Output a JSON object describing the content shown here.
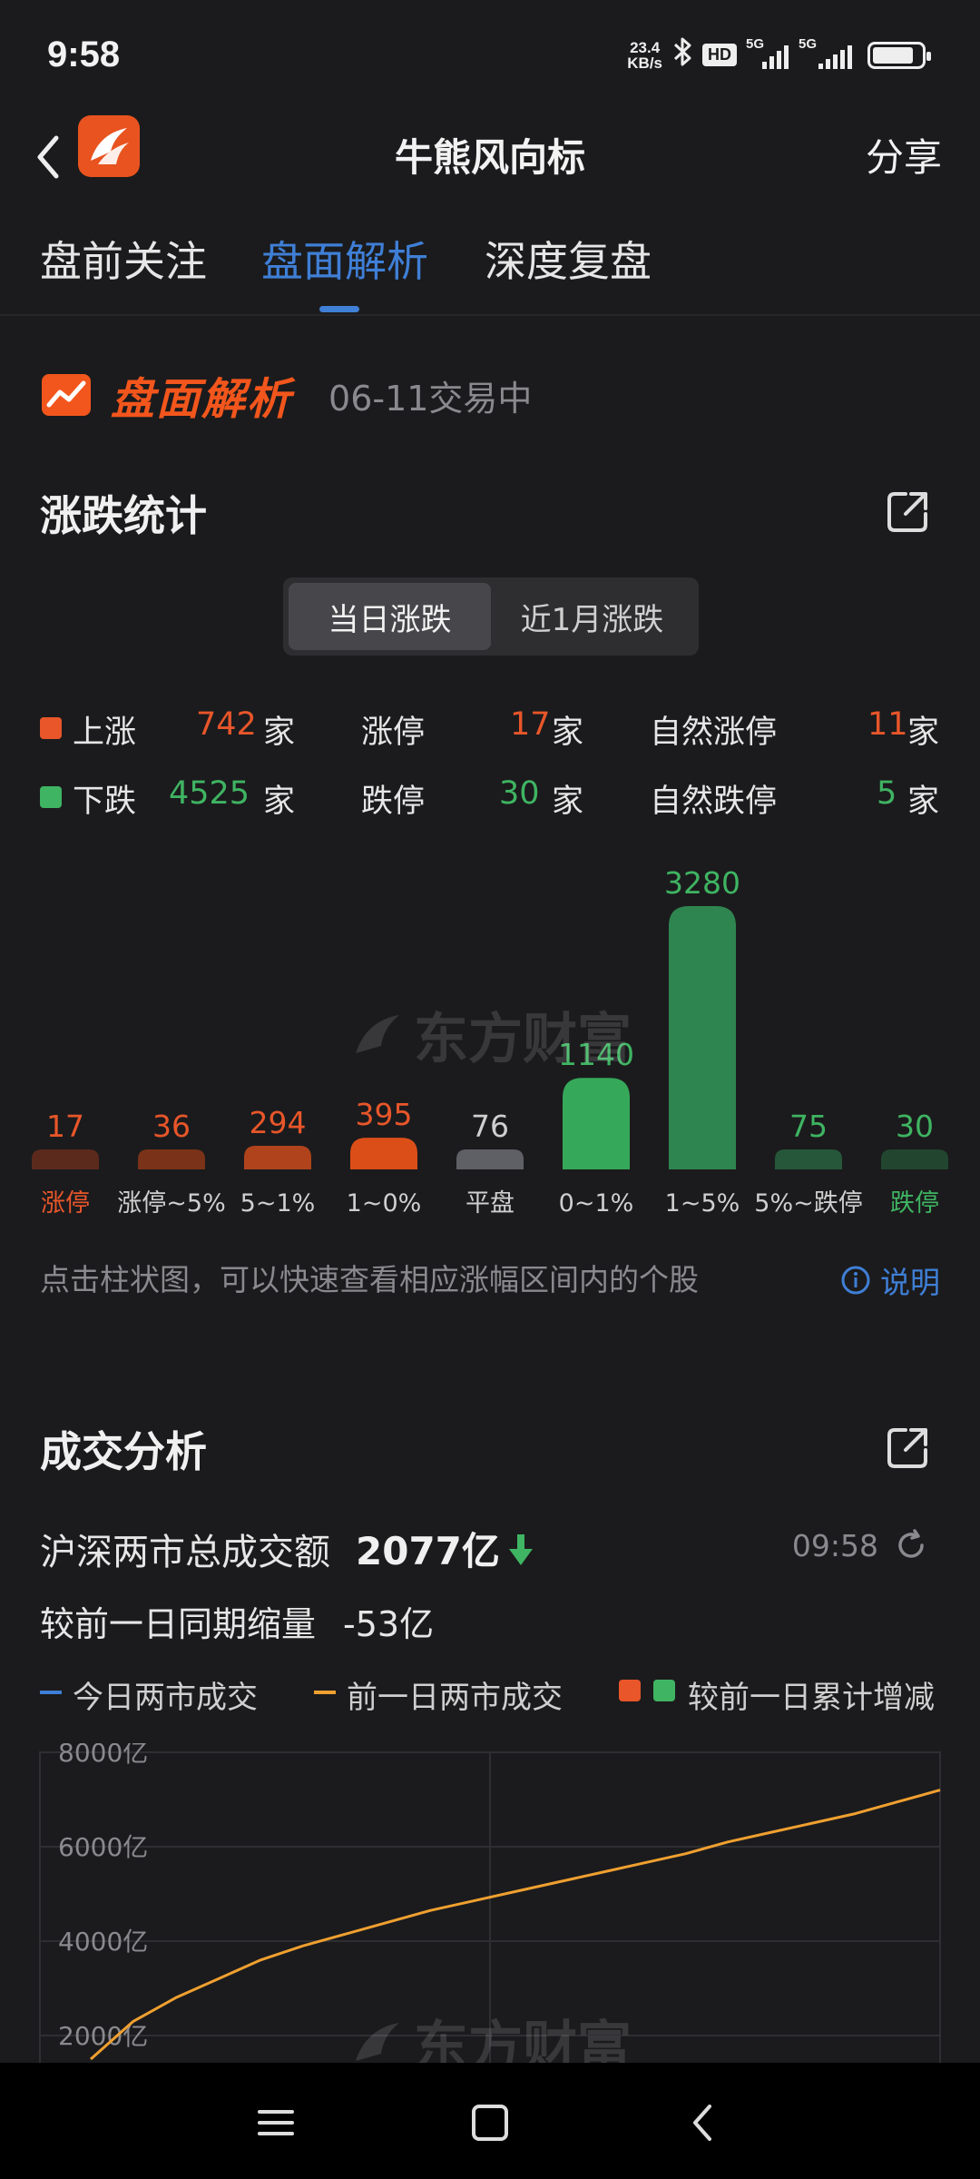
{
  "status": {
    "time": "9:58",
    "net_speed_value": "23.4",
    "net_speed_unit": "KB/s",
    "bluetooth_icon": "bluetooth-icon",
    "hd_badge": "HD",
    "signal_label_1": "5G",
    "signal_label_2": "5G",
    "battery_level": 0.85
  },
  "appbar": {
    "title": "牛熊风向标",
    "share": "分享",
    "back_icon": "back-arrow-icon",
    "logo_icon": "eastmoney-logo-icon"
  },
  "tabs": [
    {
      "label": "盘前关注",
      "active": false
    },
    {
      "label": "盘面解析",
      "active": true
    },
    {
      "label": "深度复盘",
      "active": false
    }
  ],
  "section": {
    "icon": "trend-chart-icon",
    "title": "盘面解析",
    "date": "06-11交易中"
  },
  "rise_fall": {
    "title": "涨跌统计",
    "toggle": [
      "当日涨跌",
      "近1月涨跌"
    ],
    "up": {
      "label": "上涨",
      "count": "742",
      "unit": "家"
    },
    "down": {
      "label": "下跌",
      "count": "4525",
      "unit": "家"
    },
    "limit_up": {
      "label": "涨停",
      "count": "17",
      "unit": "家"
    },
    "limit_down": {
      "label": "跌停",
      "count": "30",
      "unit": "家"
    },
    "natural_up": {
      "label": "自然涨停",
      "count": "11",
      "unit": "家"
    },
    "natural_down": {
      "label": "自然跌停",
      "count": "5",
      "unit": "家"
    },
    "hint": "点击柱状图，可以快速查看相应涨幅区间内的个股",
    "explain": "说明"
  },
  "volume": {
    "title": "成交分析",
    "total_label": "沪深两市总成交额",
    "total_value": "2077亿",
    "trend": "down",
    "time": "09:58",
    "compare_label": "较前一日同期缩量",
    "compare_value": "-53亿",
    "legend": [
      "今日两市成交",
      "前一日两市成交",
      "较前一日累计增减"
    ]
  },
  "watermark": "东方财富",
  "colors": {
    "red": "#e8562a",
    "green": "#3fb462",
    "accent": "#3f7fd6",
    "orange_line": "#f0a030",
    "blue_line": "#3f7fd6"
  },
  "chart_data": [
    {
      "type": "bar",
      "categories": [
        "涨停",
        "涨停~5%",
        "5~1%",
        "1~0%",
        "平盘",
        "0~1%",
        "1~5%",
        "5%~跌停",
        "跌停"
      ],
      "values": [
        17,
        36,
        294,
        395,
        76,
        1140,
        3280,
        75,
        30
      ],
      "colors": [
        "#5c2a1d",
        "#7a3318",
        "#b0431c",
        "#dc4e18",
        "#5f5f66",
        "#36a85a",
        "#2f8550",
        "#26573a",
        "#22452f"
      ],
      "label_colors": [
        "#e8562a",
        "#e8562a",
        "#e8562a",
        "#e8562a",
        "#cfcfcf",
        "#3fb462",
        "#3fb462",
        "#3fb462",
        "#3fb462"
      ],
      "category_colors": [
        "#e8562a",
        "#cfcfcf",
        "#cfcfcf",
        "#cfcfcf",
        "#cfcfcf",
        "#cfcfcf",
        "#cfcfcf",
        "#cfcfcf",
        "#3fb462"
      ]
    },
    {
      "type": "line",
      "ylim": [
        0,
        8000
      ],
      "y_ticks": [
        "2000亿",
        "4000亿",
        "6000亿",
        "8000亿"
      ],
      "y_tick_values": [
        2000,
        4000,
        6000,
        8000
      ],
      "grid": true,
      "series": [
        {
          "name": "前一日两市成交",
          "x": [
            0,
            0.05,
            0.1,
            0.15,
            0.2,
            0.25,
            0.3,
            0.35,
            0.4,
            0.45,
            0.5,
            0.55,
            0.6,
            0.65,
            0.7,
            0.75,
            0.8,
            0.85,
            0.9,
            0.95,
            0.98,
            1.0
          ],
          "values": [
            1500,
            2300,
            2800,
            3200,
            3600,
            3900,
            4150,
            4400,
            4650,
            4850,
            5050,
            5250,
            5450,
            5650,
            5850,
            6100,
            6300,
            6500,
            6700,
            6950,
            7100,
            7200
          ]
        }
      ]
    }
  ]
}
